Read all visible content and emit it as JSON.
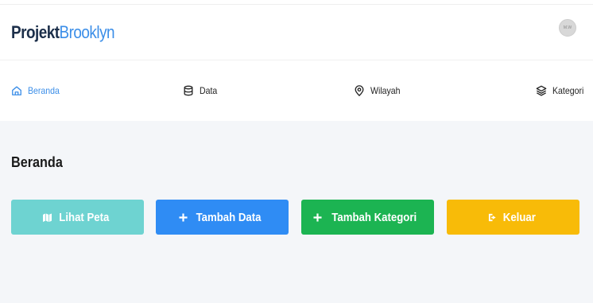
{
  "header": {
    "brand_bold": "Projekt",
    "brand_light": "Brooklyn",
    "avatar_initials": "M.W"
  },
  "nav": {
    "items": [
      {
        "label": "Beranda",
        "icon": "home-icon",
        "active": true
      },
      {
        "label": "Data",
        "icon": "database-icon",
        "active": false
      },
      {
        "label": "Wilayah",
        "icon": "map-pin-icon",
        "active": false
      },
      {
        "label": "Kategori",
        "icon": "layers-icon",
        "active": false
      }
    ]
  },
  "main": {
    "title": "Beranda",
    "buttons": [
      {
        "label": "Lihat Peta",
        "icon": "map-icon"
      },
      {
        "label": "Tambah Data",
        "icon": "plus-icon"
      },
      {
        "label": "Tambah Kategori",
        "icon": "plus-icon"
      },
      {
        "label": "Keluar",
        "icon": "logout-icon"
      }
    ]
  },
  "colors": {
    "brand_dark": "#1c2f4a",
    "brand_accent": "#3b8ee8",
    "map_button": "#6ed3d1",
    "add_data_button": "#2f8cf4",
    "add_category_button": "#1cb452",
    "logout_button": "#f8bb08"
  }
}
